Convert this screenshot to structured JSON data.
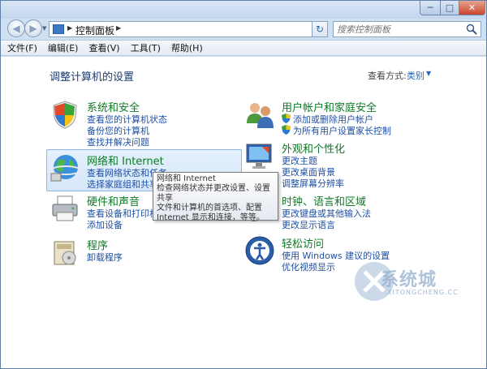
{
  "window": {
    "controls": {
      "minimize": "─",
      "maximize": "□",
      "close": "✕"
    }
  },
  "nav": {
    "address_path": "控制面板",
    "search_placeholder": "搜索控制面板"
  },
  "menu": [
    "文件(F)",
    "编辑(E)",
    "查看(V)",
    "工具(T)",
    "帮助(H)"
  ],
  "content": {
    "title": "调整计算机的设置",
    "view_by_label": "查看方式:",
    "view_by_value": "类别"
  },
  "categories": [
    {
      "title": "系统和安全",
      "icon": "shield-icon",
      "links": [
        "查看您的计算机状态",
        "备份您的计算机",
        "查找并解决问题"
      ]
    },
    {
      "title": "网络和 Internet",
      "icon": "network-globe-icon",
      "links": [
        "查看网络状态和任务",
        "选择家庭组和共享选项"
      ]
    },
    {
      "title": "硬件和声音",
      "icon": "printer-icon",
      "links": [
        "查看设备和打印机",
        "添加设备"
      ]
    },
    {
      "title": "程序",
      "icon": "programs-icon",
      "links": [
        "卸载程序"
      ]
    },
    {
      "title": "用户帐户和家庭安全",
      "icon": "users-icon",
      "links": [
        "添加或删除用户帐户",
        "为所有用户设置家长控制"
      ]
    },
    {
      "title": "外观和个性化",
      "icon": "display-icon",
      "links": [
        "更改主题",
        "更改桌面背景",
        "调整屏幕分辨率"
      ]
    },
    {
      "title": "时钟、语言和区域",
      "icon": "clock-globe-icon",
      "links": [
        "更改键盘或其他输入法",
        "更改显示语言"
      ]
    },
    {
      "title": "轻松访问",
      "icon": "ease-of-access-icon",
      "links": [
        "使用 Windows 建议的设置",
        "优化视频显示"
      ]
    }
  ],
  "tooltip": {
    "lines": [
      "网络和 Internet",
      "检查网络状态并更改设置、设置共享",
      "文件和计算机的首选项、配置",
      "Internet 显示和连接，等等。"
    ]
  },
  "watermark": {
    "text": "系统城",
    "url": "XITONGCHENG.CC"
  }
}
